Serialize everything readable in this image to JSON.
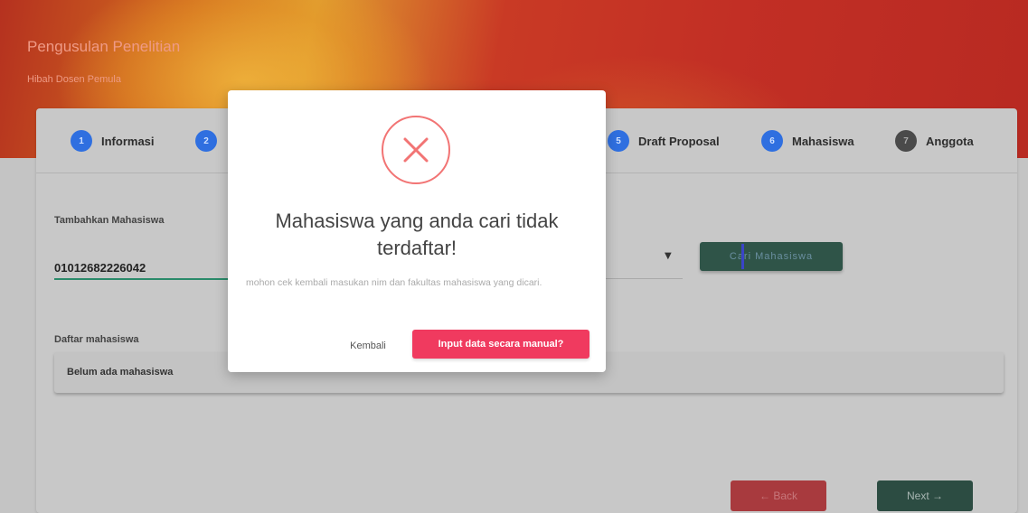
{
  "header": {
    "title": "Pengusulan Penelitian",
    "subtitle": "Hibah Dosen Pemula"
  },
  "steps": [
    {
      "number": "1",
      "label": "Informasi"
    },
    {
      "number": "2",
      "label": ""
    },
    {
      "number": "5",
      "label": "Draft Proposal"
    },
    {
      "number": "6",
      "label": "Mahasiswa"
    },
    {
      "number": "7",
      "label": "Anggota"
    }
  ],
  "form": {
    "add_label": "Tambahkan Mahasiswa",
    "nim_value": "01012682226042",
    "search_button": "Cari Mahasiswa",
    "list_label": "Daftar mahasiswa",
    "empty_text": "Belum ada mahasiswa"
  },
  "nav": {
    "back_label": "← Back",
    "next_label": "Next →"
  },
  "modal": {
    "icon": "error-x-icon",
    "title": "Mahasiswa yang anda cari tidak terdaftar!",
    "description": "mohon cek kembali masukan nim dan fakultas mahasiswa yang dicari.",
    "cancel_label": "Kembali",
    "confirm_label": "Input data secara manual?",
    "accent_color": "#f27474",
    "confirm_color": "#f03a5f"
  }
}
